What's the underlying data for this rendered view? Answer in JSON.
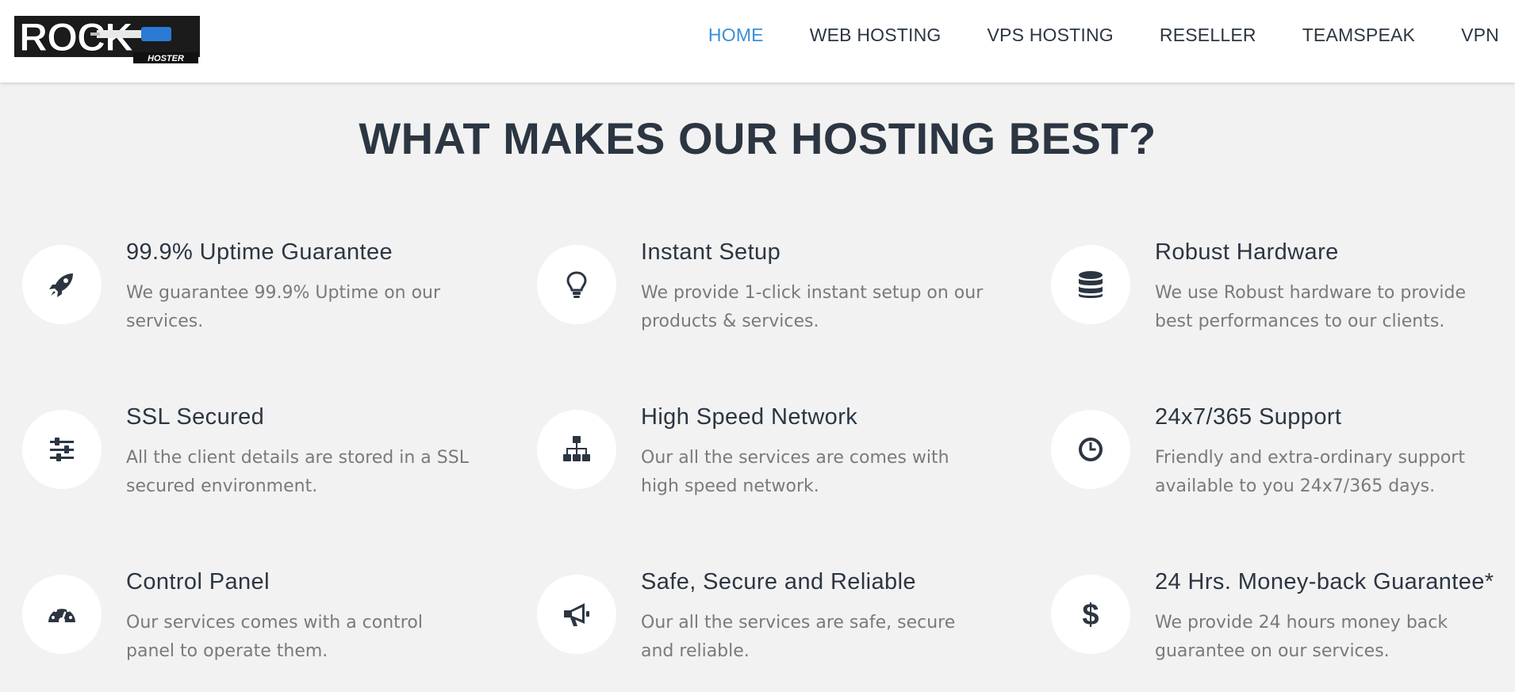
{
  "header": {
    "logo": {
      "text": "ROCK",
      "subtext": "HOSTER"
    },
    "nav": [
      {
        "label": "HOME",
        "active": true
      },
      {
        "label": "WEB HOSTING",
        "active": false
      },
      {
        "label": "VPS HOSTING",
        "active": false
      },
      {
        "label": "RESELLER",
        "active": false
      },
      {
        "label": "TEAMSPEAK",
        "active": false
      },
      {
        "label": "VPN",
        "active": false
      }
    ]
  },
  "colors": {
    "accent": "#3a8fd6",
    "heading": "#2c3642",
    "body_text": "#7a7a7a",
    "background": "#f2f2f2"
  },
  "main": {
    "title": "WHAT MAKES OUR HOSTING BEST?",
    "features": [
      {
        "icon": "rocket-icon",
        "title": "99.9% Uptime Guarantee",
        "text": "We guarantee 99.9% Uptime on our services."
      },
      {
        "icon": "lightbulb-icon",
        "title": "Instant Setup",
        "text": "We provide 1-click instant setup on our products & services."
      },
      {
        "icon": "database-icon",
        "title": "Robust Hardware",
        "text": "We use Robust hardware to provide best performances to our clients."
      },
      {
        "icon": "sliders-icon",
        "title": "SSL Secured",
        "text": "All the client details are stored in a SSL secured environment."
      },
      {
        "icon": "network-icon",
        "title": "High Speed Network",
        "text": "Our all the services are comes with high speed network."
      },
      {
        "icon": "clock-icon",
        "title": "24x7/365 Support",
        "text": "Friendly and extra-ordinary support available to you 24x7/365 days."
      },
      {
        "icon": "dashboard-icon",
        "title": "Control Panel",
        "text": "Our services comes with a control panel to operate them."
      },
      {
        "icon": "megaphone-icon",
        "title": "Safe, Secure and Reliable",
        "text": "Our all the services are safe, secure and reliable."
      },
      {
        "icon": "dollar-icon",
        "title": "24 Hrs. Money-back Guarantee*",
        "text": "We provide 24 hours money back guarantee on our services."
      }
    ]
  }
}
